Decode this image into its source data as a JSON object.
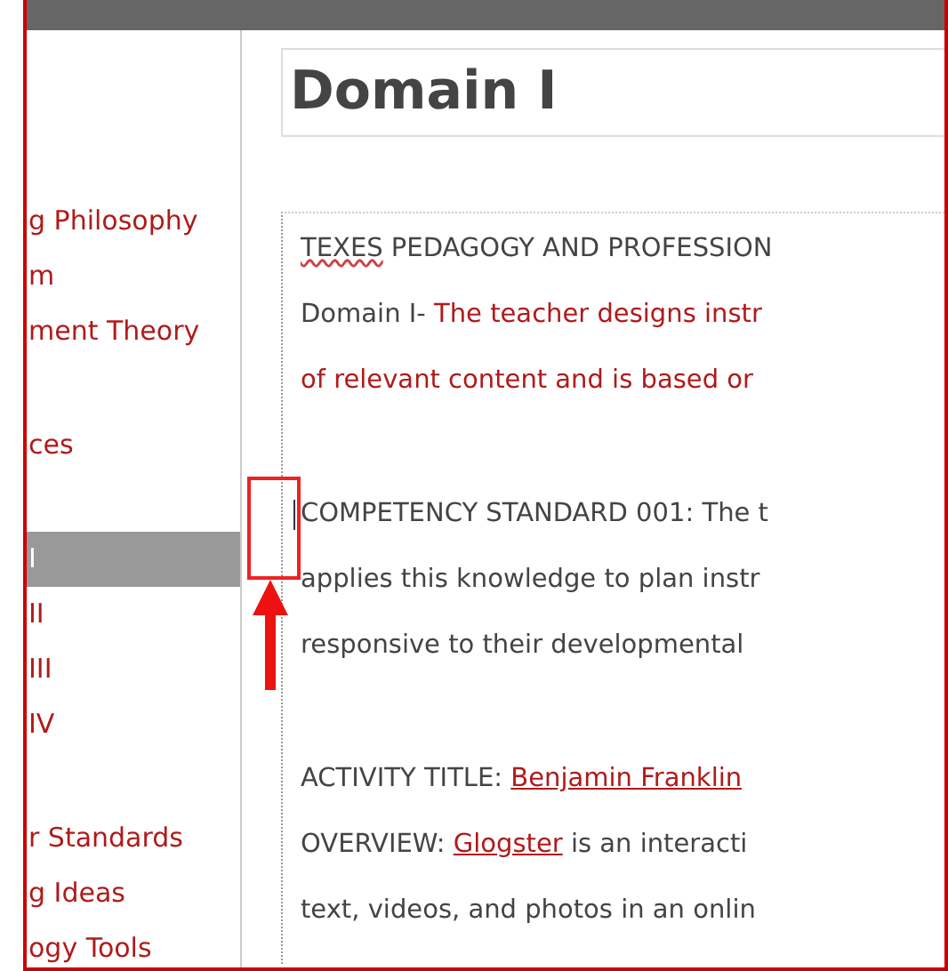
{
  "page_title": "Domain I",
  "sidebar": {
    "groups": [
      {
        "items": [
          {
            "label": "g Philosophy",
            "selected": false
          },
          {
            "label": "m",
            "selected": false
          },
          {
            "label": "ment Theory",
            "selected": false
          }
        ]
      },
      {
        "items": [
          {
            "label": "ces",
            "selected": false
          }
        ]
      },
      {
        "items": [
          {
            "label": "I",
            "selected": true
          },
          {
            "label": "II",
            "selected": false
          },
          {
            "label": "III",
            "selected": false
          },
          {
            "label": "IV",
            "selected": false
          }
        ]
      },
      {
        "items": [
          {
            "label": "r Standards",
            "selected": false
          },
          {
            "label": "g Ideas",
            "selected": false
          },
          {
            "label": "ogy Tools",
            "selected": false
          }
        ]
      }
    ]
  },
  "editor": {
    "paragraphs": [
      {
        "caret": false,
        "lines": [
          [
            {
              "kind": "misspelled",
              "text": "TEXES"
            },
            {
              "kind": "plain",
              "text": " PEDAGOGY AND PROFESSION"
            }
          ],
          [
            {
              "kind": "plain",
              "text": "Domain I- "
            },
            {
              "kind": "red",
              "text": "The teacher designs instr"
            }
          ],
          [
            {
              "kind": "red",
              "text": "of relevant content and is based or"
            }
          ]
        ]
      },
      {
        "caret": true,
        "lines": [
          [
            {
              "kind": "plain",
              "text": "COMPETENCY STANDARD 001: The t"
            }
          ],
          [
            {
              "kind": "plain",
              "text": "applies this knowledge to plan instr"
            }
          ],
          [
            {
              "kind": "plain",
              "text": "responsive to their developmental"
            }
          ]
        ]
      },
      {
        "caret": false,
        "lines": [
          [
            {
              "kind": "plain",
              "text": "ACTIVITY TITLE: "
            },
            {
              "kind": "link",
              "text": "Benjamin Franklin"
            }
          ],
          [
            {
              "kind": "plain",
              "text": "OVERVIEW: "
            },
            {
              "kind": "link",
              "text": "Glogster"
            },
            {
              "kind": "plain",
              "text": " is an interacti"
            }
          ],
          [
            {
              "kind": "plain",
              "text": "text, videos, and photos in an onlin"
            }
          ]
        ]
      }
    ]
  }
}
